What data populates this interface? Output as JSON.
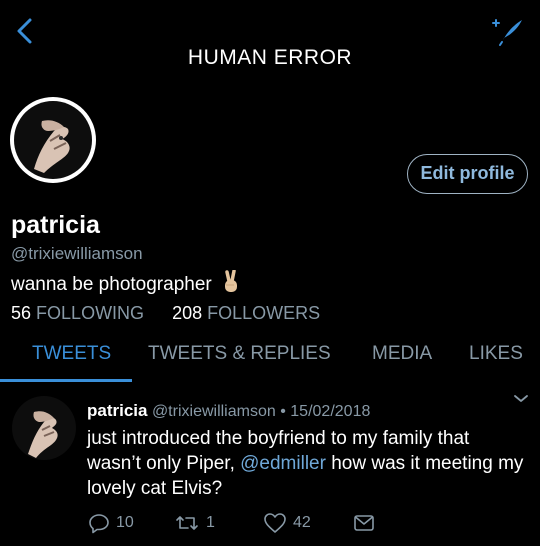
{
  "header": {
    "title": "HUMAN ERROR",
    "back_icon": "chevron-left-icon",
    "compose_icon": "compose-sparkle-icon"
  },
  "profile": {
    "name": "patricia",
    "handle": "@trixiewilliamson",
    "bio": "wanna be photographer",
    "bio_emoji": "victory-hand-emoji",
    "edit_label": "Edit profile",
    "following_count": "56",
    "following_label": "FOLLOWING",
    "followers_count": "208",
    "followers_label": "FOLLOWERS"
  },
  "tabs": [
    {
      "label": "TWEETS",
      "active": true
    },
    {
      "label": "TWEETS & REPLIES",
      "active": false
    },
    {
      "label": "MEDIA",
      "active": false
    },
    {
      "label": "LIKES",
      "active": false
    }
  ],
  "tweet": {
    "name": "patricia",
    "handle": "@trixiewilliamson",
    "separator": "•",
    "date": "15/02/2018",
    "text_before": "just introduced the boyfriend to my family that wasn’t only Piper, ",
    "mention": "@edmiller",
    "text_after": " how was it meeting my lovely cat Elvis?",
    "reply_count": "10",
    "retweet_count": "1",
    "like_count": "42"
  },
  "colors": {
    "background": "#000000",
    "accent": "#3a8fd9",
    "muted": "#8899a6",
    "mention": "#6fa8d8"
  }
}
